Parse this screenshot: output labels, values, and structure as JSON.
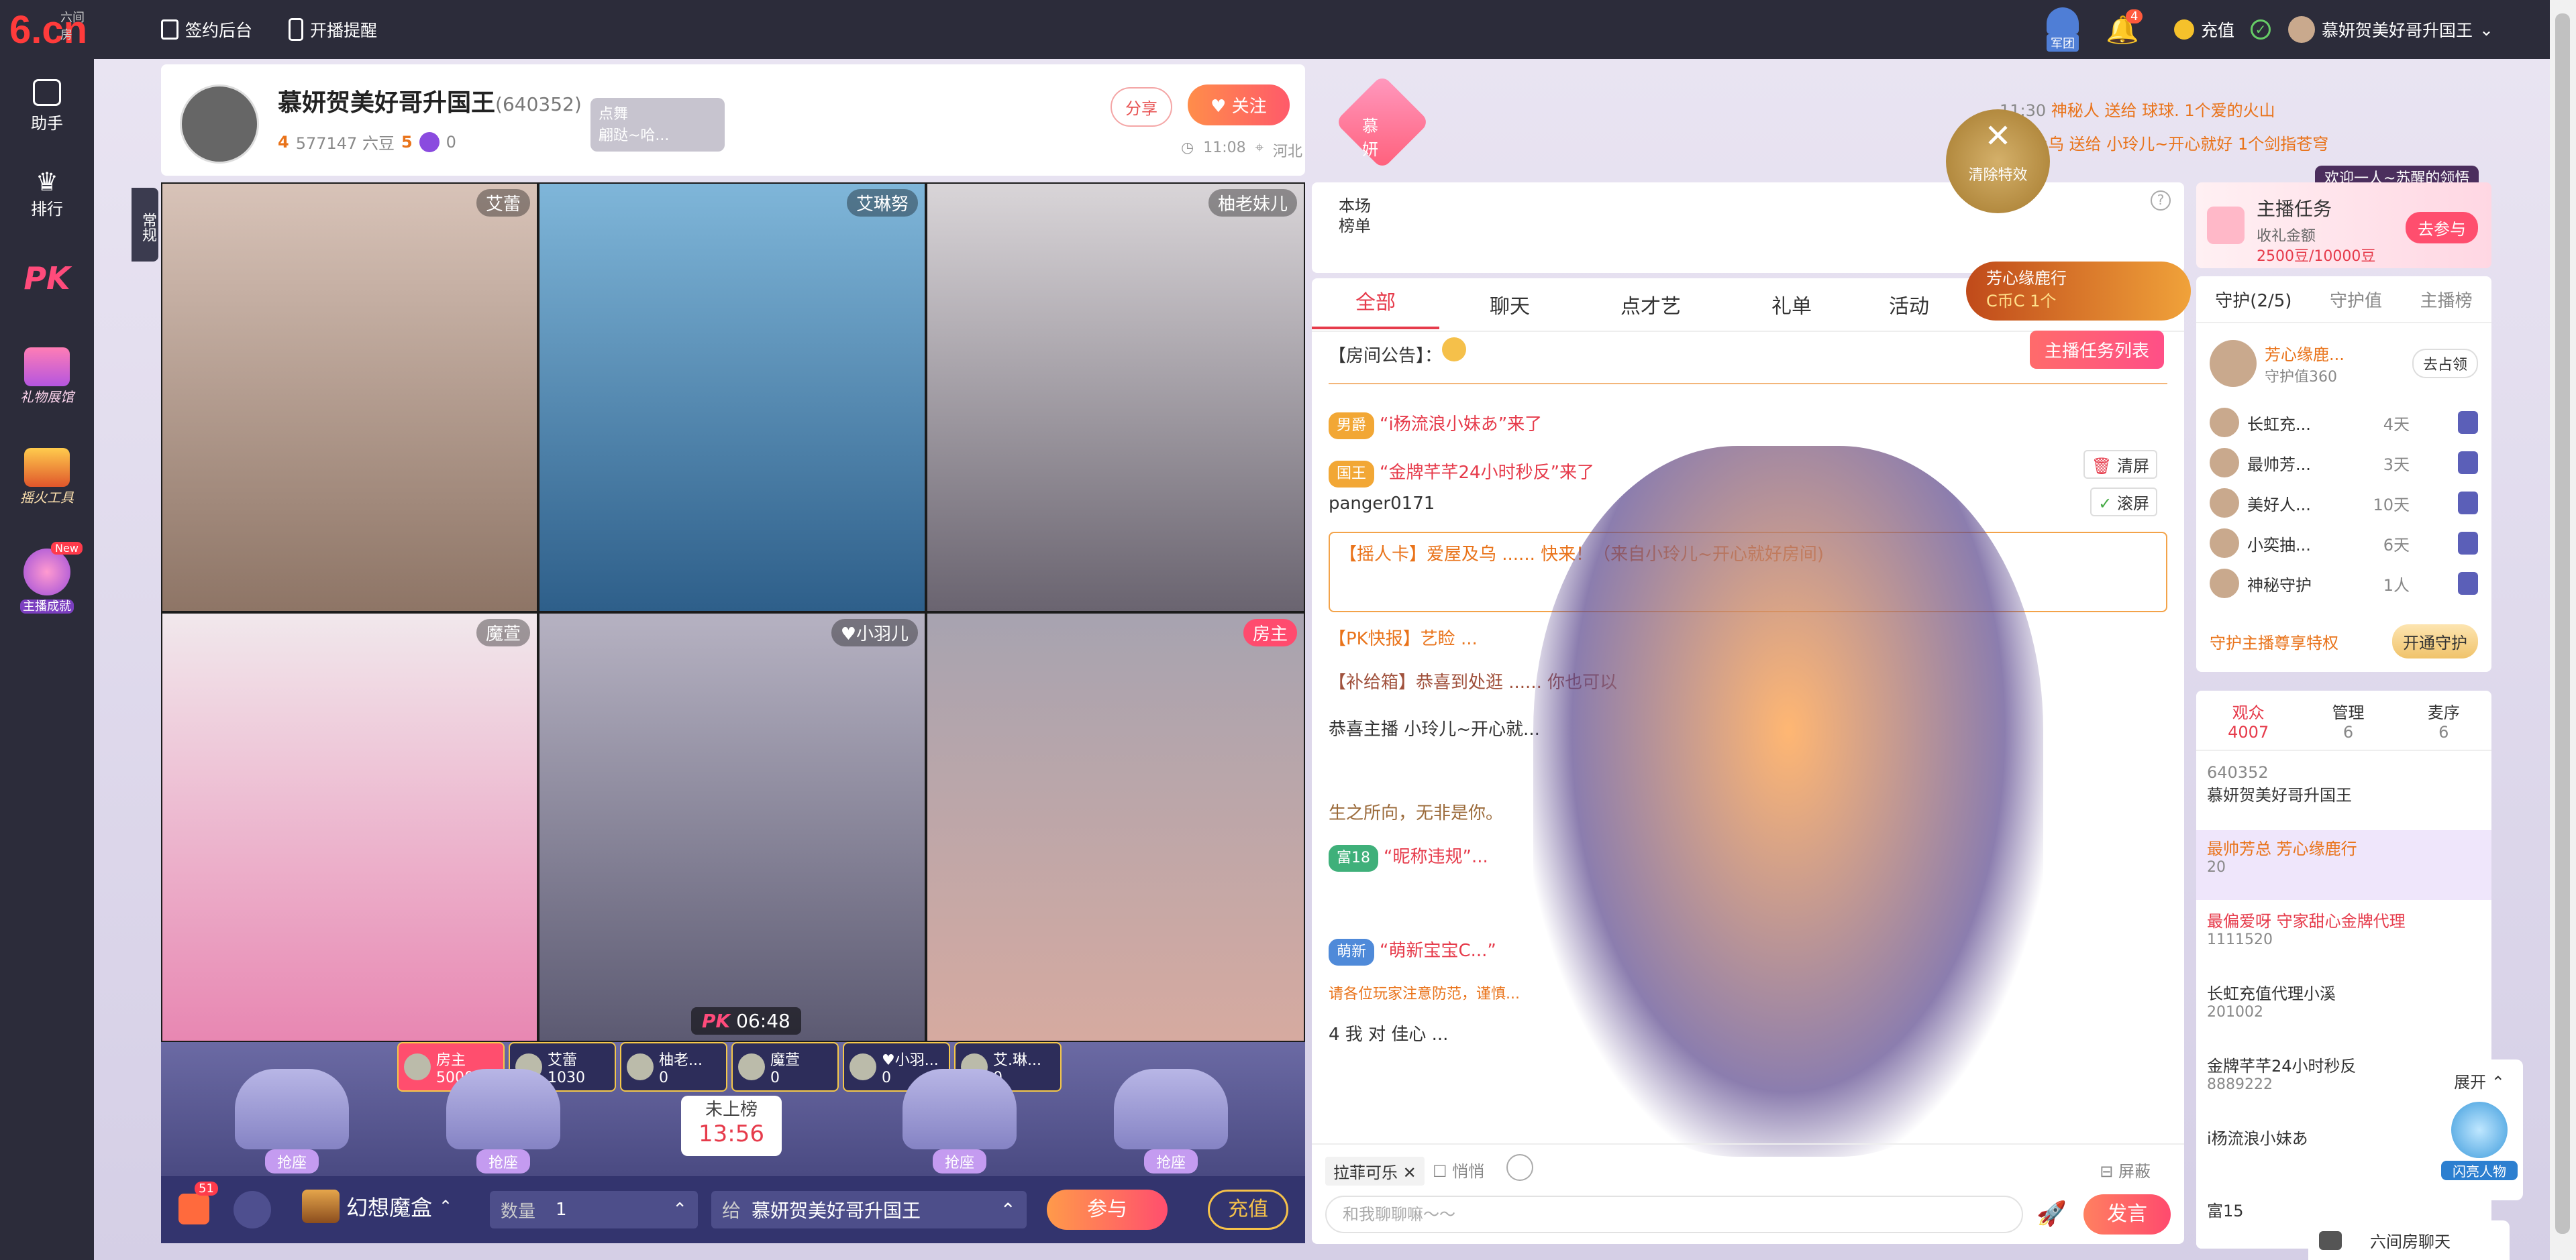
{
  "topbar": {
    "logo_small": "六间房",
    "logo_big": "6.cn",
    "sign": "签约后台",
    "remind": "开播提醒",
    "army": "军团",
    "bell_count": "4",
    "recharge": "充值",
    "username": "慕妍贺美好哥升国王"
  },
  "sidebar": {
    "items": [
      {
        "label": "助手"
      },
      {
        "label": "排行"
      },
      {
        "label": "PK"
      },
      {
        "label": "礼物展馆"
      },
      {
        "label": "摇火工具"
      },
      {
        "label": "主播成就",
        "badge": "New"
      }
    ]
  },
  "anchor": {
    "name": "慕妍贺美好哥升国王",
    "room_id": "(640352)",
    "level": "4",
    "fans": "577147 六豆",
    "level2": "5",
    "points": "0",
    "dance_title": "点舞",
    "dance_song": "翩跶~哈...",
    "share": "分享",
    "follow": "关注",
    "heart_name": "慕妍",
    "time": "11:08",
    "location": "河北"
  },
  "mode_tag": "常规",
  "videos": [
    {
      "name": "艾蕾"
    },
    {
      "name": "艾琳努"
    },
    {
      "name": "柚老妹儿"
    },
    {
      "name": "魔萱"
    },
    {
      "name": "♥小羽儿"
    },
    {
      "name": "房主"
    }
  ],
  "pk": {
    "label": "PK",
    "time": "06:48"
  },
  "score_tabs": [
    {
      "name": "房主",
      "score": "5000"
    },
    {
      "name": "艾蕾",
      "score": "1030"
    },
    {
      "name": "柚老...",
      "score": "0"
    },
    {
      "name": "魔萱",
      "score": "0"
    },
    {
      "name": "♥小羽...",
      "score": "0"
    },
    {
      "name": "艾.琳...",
      "score": "0"
    }
  ],
  "seats": {
    "grab": "抢座",
    "timer_title": "未上榜",
    "timer": "13:56"
  },
  "bottom": {
    "gift_count": "51",
    "magic_box": "幻想魔盒",
    "qty_label": "数量",
    "qty": "1",
    "to_label": "给",
    "to_name": "慕妍贺美好哥升国王",
    "join": "参与",
    "recharge": "充值"
  },
  "notifications": {
    "line1_time": "11:30",
    "line1": "神秘人 送给 球球. 1个爱的火山",
    "line2": "爱屋及乌 送给 小玲儿~开心就好 1个剑指苍穹",
    "line3": "欢迎一人~苏醒的领悟"
  },
  "clear_effects": "清除特效",
  "rank_box": {
    "title": "本场榜单"
  },
  "promo": {
    "name": "芳心缘鹿行",
    "sub": "C币C 1个"
  },
  "task": {
    "title": "主播任务",
    "sub": "收礼金额",
    "progress_text": "2500豆/10000豆",
    "progress": 0.25,
    "join": "去参与"
  },
  "chat": {
    "tabs": [
      "全部",
      "聊天",
      "点才艺",
      "礼单",
      "活动"
    ],
    "announce_label": "【房间公告】：",
    "task_list": "主播任务列表",
    "clear": "清屏",
    "scroll": "滚屏",
    "messages": [
      {
        "badge": "男爵",
        "text": "“i杨流浪小妹あ”来了"
      },
      {
        "badge": "国王",
        "text": "“金牌芊芊24小时秒反”来了"
      },
      {
        "text": "panger0171"
      },
      {
        "text": "【摇人卡】爱屋及乌 ...... 快来！（来自小玲儿~开心就好房间)"
      },
      {
        "text": "【PK快报】艺睑 ..."
      },
      {
        "text": "【补给箱】恭喜到处逛 ...... 你也可以"
      },
      {
        "text": "恭喜主播 小玲儿~开心就..."
      },
      {
        "text": "生之所向，无非是你。"
      },
      {
        "badge": "富18",
        "text": "“昵称违规”..."
      },
      {
        "badge": "萌新",
        "text": "“萌新宝宝C...”"
      },
      {
        "text": "请各位玩家注意防范，谨慎..."
      },
      {
        "text": "4 我 对 佳心 ..."
      }
    ],
    "input_target": "拉菲可乐",
    "private_label": "悄悄",
    "block_label": "屏蔽",
    "placeholder": "和我聊聊嘛～～",
    "send": "发言"
  },
  "guard": {
    "tabs": [
      "守护(2/5)",
      "守护值",
      "主播榜"
    ],
    "top_name": "芳心缘鹿...",
    "top_sub": "守护值360",
    "occupy": "去占领",
    "list": [
      {
        "name": "长虹充...",
        "days": "4天"
      },
      {
        "name": "最帅芳...",
        "days": "3天"
      },
      {
        "name": "美好人...",
        "days": "10天"
      },
      {
        "name": "小奕抽...",
        "days": "6天"
      },
      {
        "name": "神秘守护",
        "days": "1人"
      }
    ],
    "privilege": "守护主播尊享特权",
    "open": "开通守护"
  },
  "viewers": {
    "tabs": [
      {
        "label": "观众",
        "count": "4007"
      },
      {
        "label": "管理",
        "count": "6"
      },
      {
        "label": "麦序",
        "count": "6"
      }
    ],
    "list": [
      {
        "id": "640352",
        "name": "慕妍贺美好哥升国王"
      },
      {
        "name": "最帅芳总 芳心缘鹿行",
        "num": "20"
      },
      {
        "name": "最偏爱呀 守家甜心金牌代理",
        "num": "1111520"
      },
      {
        "name": "长虹充值代理小溪",
        "num": "201002"
      },
      {
        "name": "金牌芊芊24小时秒反",
        "num": "8889222"
      },
      {
        "name": "i杨流浪小妹あ"
      },
      {
        "name": "富15"
      }
    ]
  },
  "floating": {
    "expand": "展开",
    "flash": "闪亮人物",
    "room_chat": "六间房聊天"
  },
  "colors": {
    "accent": "#ff5a4e",
    "purple": "#7a5cc9",
    "dark": "#2c2c3a"
  }
}
